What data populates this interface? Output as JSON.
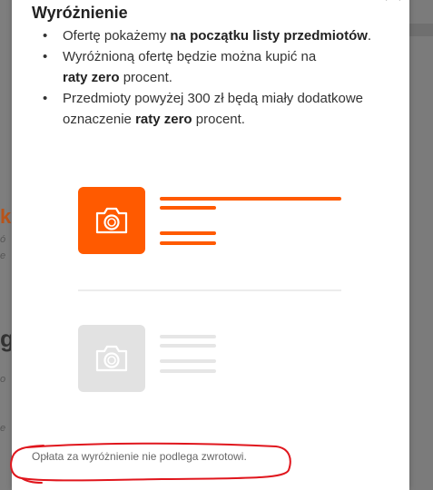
{
  "background_fragments": [
    "k",
    "ó",
    "e",
    "g",
    "o",
    "e"
  ],
  "modal": {
    "title": "Wyróżnienie",
    "bullets": [
      {
        "pre": "Ofertę pokażemy ",
        "bold": "na początku listy przedmiotów",
        "post": "."
      },
      {
        "pre": "Wyróżnioną ofertę będzie można kupić na ",
        "bold": "raty zero",
        "post": " procent."
      },
      {
        "pre": "Przedmioty powyżej 300 zł będą miały dodatkowe oznaczenie ",
        "bold": "raty zero",
        "post": " procent."
      }
    ],
    "illustration": {
      "featured_icon": "camera-icon",
      "regular_icon": "camera-icon",
      "featured_color": "#ff5a00",
      "regular_color": "#e2e2e2"
    },
    "footnote": "Opłata za wyróżnienie nie podlega zwrotowi.",
    "close_icon": "close-icon"
  },
  "annotation_color": "#e0161d"
}
